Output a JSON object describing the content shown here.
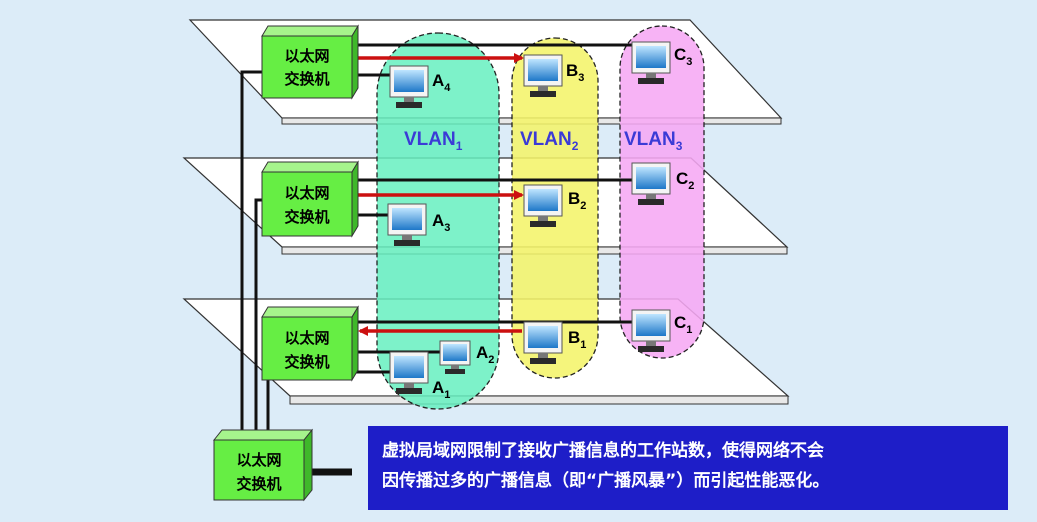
{
  "switch_label": [
    "以太网",
    "交换机"
  ],
  "vlans": [
    {
      "name": "VLAN",
      "sub": "1"
    },
    {
      "name": "VLAN",
      "sub": "2"
    },
    {
      "name": "VLAN",
      "sub": "3"
    }
  ],
  "stations": [
    {
      "letter": "A",
      "sub": "4"
    },
    {
      "letter": "B",
      "sub": "3"
    },
    {
      "letter": "C",
      "sub": "3"
    },
    {
      "letter": "A",
      "sub": "3"
    },
    {
      "letter": "B",
      "sub": "2"
    },
    {
      "letter": "C",
      "sub": "2"
    },
    {
      "letter": "A",
      "sub": "2"
    },
    {
      "letter": "A",
      "sub": "1"
    },
    {
      "letter": "B",
      "sub": "1"
    },
    {
      "letter": "C",
      "sub": "1"
    }
  ],
  "note": {
    "line1": "虚拟局域网限制了接收广播信息的工作站数，使得网络不会",
    "line2": "因传播过多的广播信息（即“广播风暴”）而引起性能恶化。"
  },
  "colors": {
    "vlan1": "#66f0c0",
    "vlan2": "#f4f46a",
    "vlan3": "#f6a8f4",
    "switch": "#66ee44",
    "arrow": "#cc1010",
    "note_bg": "#1e1ec8"
  }
}
